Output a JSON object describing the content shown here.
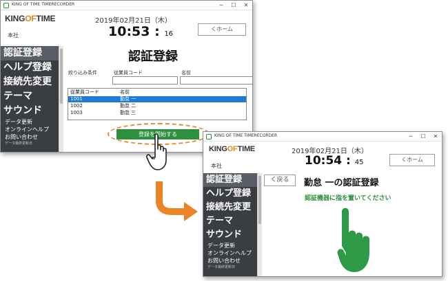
{
  "window1": {
    "title": "KING OF TIME TIMERECORDER",
    "logo": {
      "part1": "KING",
      "part2": "OF",
      "part3": "TIME"
    },
    "office": "本社",
    "date": "2019年02月21日（木）",
    "time": {
      "hm": "10:53",
      "sec": "16"
    },
    "home_button": "くホーム",
    "sidebar": {
      "items": [
        "認証登録",
        "ヘルプ登録",
        "接続先変更",
        "テーマ",
        "サウンド"
      ],
      "small_items": [
        "データ更新",
        "オンラインヘルプ",
        "お問い合わせ"
      ],
      "footer": "データ最終更新日"
    },
    "page_title": "認証登録",
    "filter": {
      "label": "絞り込み条件",
      "employee_code_label": "従業員コード",
      "name_label": "名前",
      "employee_code_value": "",
      "name_value": ""
    },
    "list": {
      "headers": [
        "従業員コード",
        "名前"
      ],
      "rows": [
        {
          "code": "1001",
          "name": "勤怠 一"
        },
        {
          "code": "1002",
          "name": "勤怠 二"
        },
        {
          "code": "1003",
          "name": "勤怠 三"
        }
      ]
    },
    "start_button": "登録を開始する"
  },
  "window2": {
    "title": "KING OF TIME TIMERECORDER",
    "logo": {
      "part1": "KING",
      "part2": "OF",
      "part3": "TIME"
    },
    "office": "本社",
    "date": "2019年02月21日（木）",
    "time": {
      "hm": "10:54",
      "sec": "45"
    },
    "home_button": "くホーム",
    "back_button": "く戻る",
    "sidebar": {
      "items": [
        "認証登録",
        "ヘルプ登録",
        "接続先変更",
        "テーマ",
        "サウンド"
      ],
      "small_items": [
        "データ更新",
        "オンラインヘルプ",
        "お問い合わせ"
      ],
      "footer": "データ最終更新日"
    },
    "page_title": "勤怠 一の認証登録",
    "instruction": "認証機器に指を置いてください"
  },
  "colors": {
    "accent_green": "#2e8f3e",
    "highlight_orange": "#e8892a",
    "sidebar_bg": "#3a3d42",
    "selection_blue": "#1e7ad6"
  },
  "icons": {
    "cursor": "hand-pointer-icon",
    "flow": "curved-arrow-icon",
    "finger": "hand-finger-icon"
  }
}
